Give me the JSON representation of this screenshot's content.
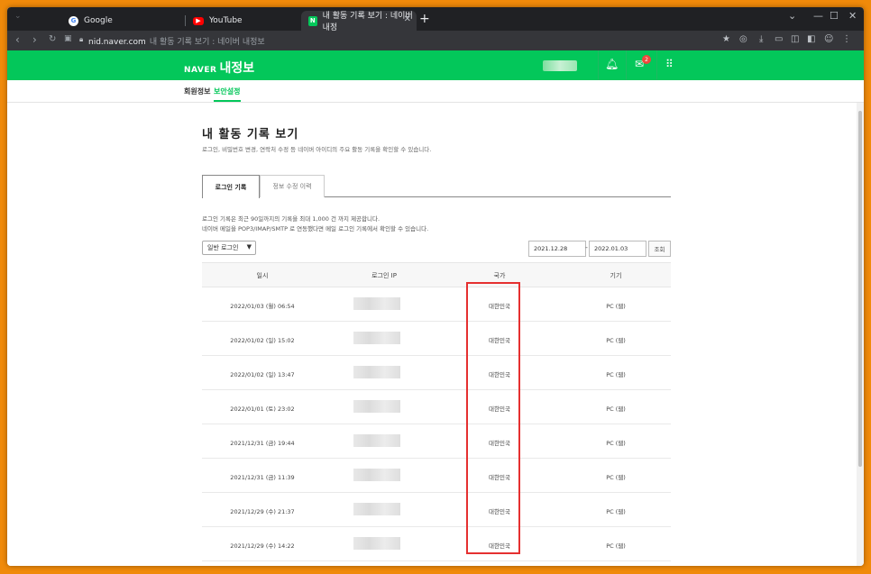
{
  "browser": {
    "tabs": [
      {
        "label": "Google"
      },
      {
        "label": "YouTube"
      },
      {
        "label": "내 활동 기록 보기 : 네이버 내정"
      }
    ],
    "url_host": "nid.naver.com",
    "url_title": "내 활동 기록 보기 : 네이버 내정보"
  },
  "header": {
    "brand": "NAVER",
    "service": "내정보",
    "mail_badge": "2"
  },
  "subnav": {
    "items": [
      {
        "label": "회원정보"
      },
      {
        "label": "보안설정"
      }
    ]
  },
  "page": {
    "title": "내 활동 기록 보기",
    "description": "로그인, 비밀번호 변경, 연락처 수정 등 네이버 아이디의 주요 활동 기록을 확인할 수 있습니다.",
    "tabs": [
      {
        "label": "로그인 기록"
      },
      {
        "label": "정보 수정 이력"
      }
    ],
    "info_line1": "로그인 기록은 최근 90일까지의 기록을 최대 1,000 건 까지 제공합니다.",
    "info_line2": "네이버 메일을 POP3/IMAP/SMTP 로 연동했다면 메일 로그인 기록에서 확인할 수 있습니다.",
    "filter_select": "일반 로그인",
    "date_from": "2021.12.28",
    "date_to": "2022.01.03",
    "query_button": "조회"
  },
  "table": {
    "headers": [
      "일시",
      "로그인 IP",
      "국가",
      "기기"
    ],
    "rows": [
      {
        "datetime": "2022/01/03 (월) 06:54",
        "country": "대한민국",
        "device": "PC (웹)"
      },
      {
        "datetime": "2022/01/02 (일) 15:02",
        "country": "대한민국",
        "device": "PC (웹)"
      },
      {
        "datetime": "2022/01/02 (일) 13:47",
        "country": "대한민국",
        "device": "PC (웹)"
      },
      {
        "datetime": "2022/01/01 (토) 23:02",
        "country": "대한민국",
        "device": "PC (웹)"
      },
      {
        "datetime": "2021/12/31 (금) 19:44",
        "country": "대한민국",
        "device": "PC (웹)"
      },
      {
        "datetime": "2021/12/31 (금) 11:39",
        "country": "대한민국",
        "device": "PC (웹)"
      },
      {
        "datetime": "2021/12/29 (수) 21:37",
        "country": "대한민국",
        "device": "PC (웹)"
      },
      {
        "datetime": "2021/12/29 (수) 14:22",
        "country": "대한민국",
        "device": "PC (웹)"
      }
    ]
  },
  "colors": {
    "naver_green": "#03c75a",
    "highlight_red": "#e53030",
    "background_orange": "#f08a0a"
  }
}
